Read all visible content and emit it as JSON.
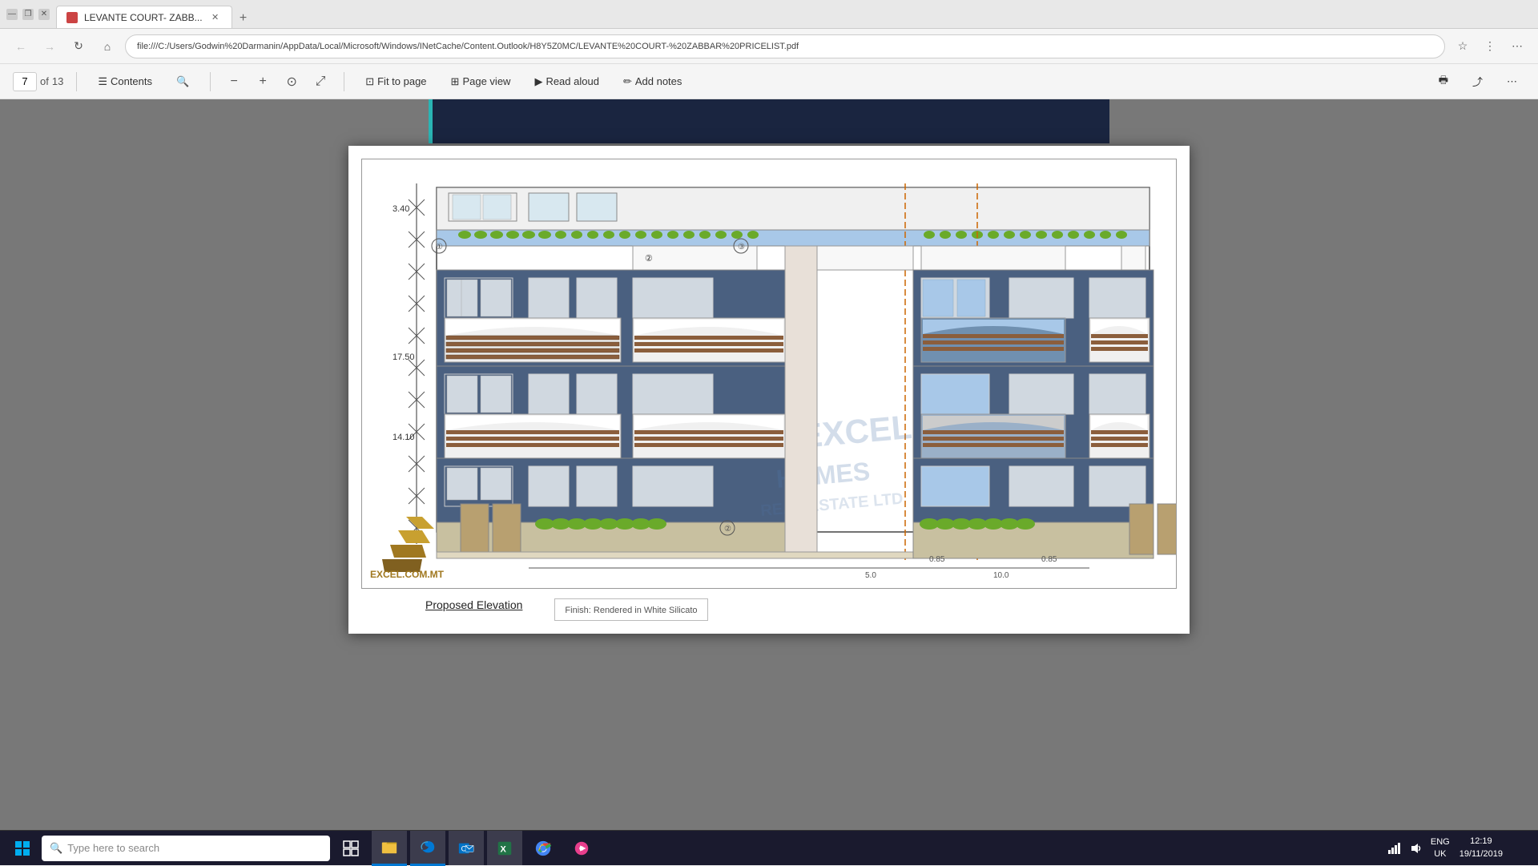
{
  "browser": {
    "tab_title": "LEVANTE COURT- ZABB...",
    "address": "file:///C:/Users/Godwin%20Darmanin/AppData/Local/Microsoft/Windows/INetCache/Content.Outlook/H8Y5Z0MC/LEVANTE%20COURT-%20ZABBAR%20PRICELIST.pdf",
    "page_current": "7",
    "page_total": "13",
    "toolbar": {
      "contents_label": "Contents",
      "fit_to_page_label": "Fit to page",
      "page_view_label": "Page view",
      "read_aloud_label": "Read aloud",
      "add_notes_label": "Add notes"
    }
  },
  "pdf": {
    "caption": "Proposed Elevation",
    "description": "Finish: Rendered in White Silicato"
  },
  "taskbar": {
    "search_placeholder": "Type here to search",
    "clock_time": "12:19",
    "clock_date": "19/11/2019",
    "language": "ENG",
    "region": "UK"
  },
  "colors": {
    "building_dark": "#4a6080",
    "building_light": "#c8d4dc",
    "balcony_wood": "#8b5e3c",
    "window_blue": "#a8c8e8",
    "green_plants": "#6aaa2a",
    "header_bg": "#1a2540",
    "accent_teal": "#2ab4b4"
  }
}
